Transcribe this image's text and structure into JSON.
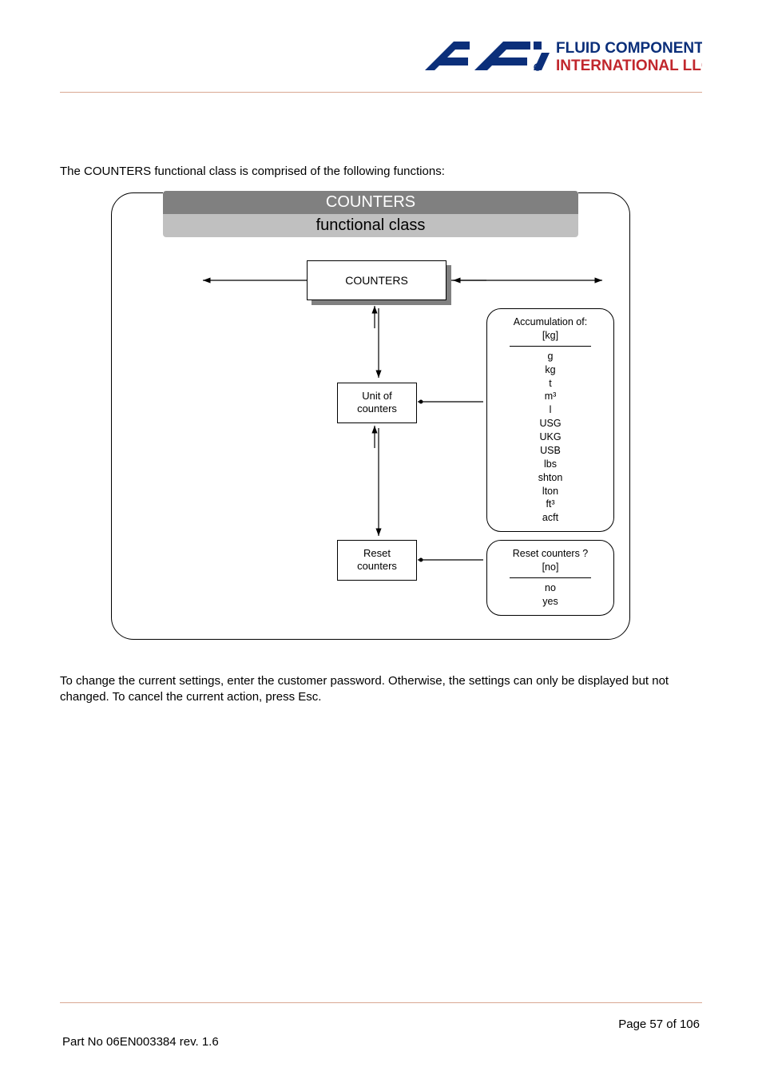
{
  "logo": {
    "line1": "FLUID COMPONENTS",
    "line2": "INTERNATIONAL LLC"
  },
  "intro_text": "The COUNTERS functional class is comprised of the following functions:",
  "diagram": {
    "title_top": "COUNTERS",
    "title_bottom": "functional class",
    "counters_label": "COUNTERS",
    "unit_label_l1": "Unit of",
    "unit_label_l2": "counters",
    "reset_label_l1": "Reset",
    "reset_label_l2": "counters",
    "accum": {
      "header": "Accumulation of:",
      "current": "[kg]",
      "options": [
        "g",
        "kg",
        "t",
        "m³",
        "l",
        "USG",
        "UKG",
        "USB",
        "lbs",
        "shton",
        "lton",
        "ft³",
        "acft"
      ]
    },
    "reset_bubble": {
      "header": "Reset counters ?",
      "current": "[no]",
      "options": [
        "no",
        "yes"
      ]
    }
  },
  "footer_text": "To change the current settings, enter the customer password. Otherwise, the settings can only be displayed but not changed. To cancel the current action, press Esc.",
  "page_info": {
    "page_label": "Page 57 of 106",
    "part_label": "Part No 06EN003384 rev. 1.6"
  }
}
